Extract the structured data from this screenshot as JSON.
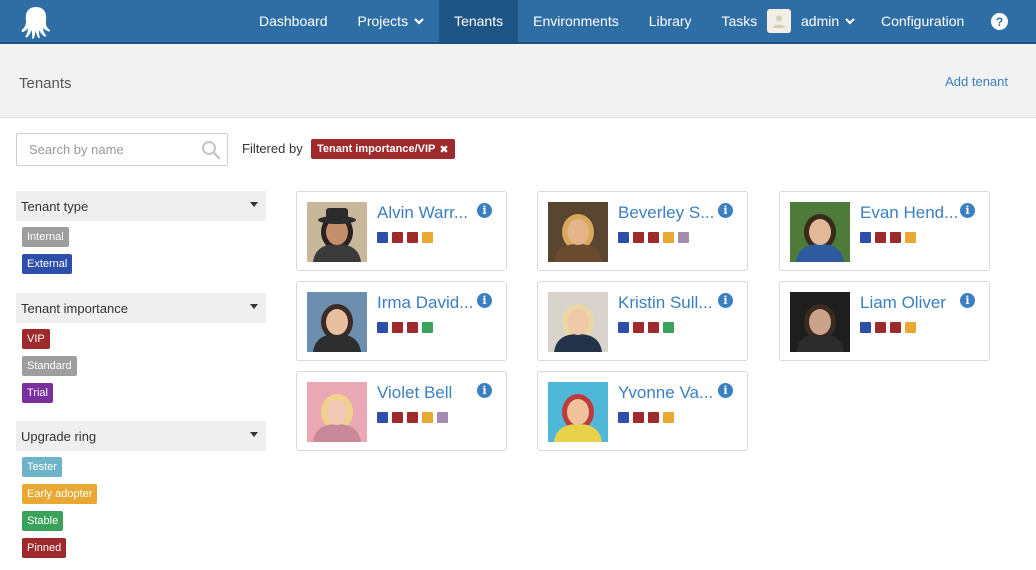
{
  "nav": {
    "items": [
      {
        "label": "Dashboard",
        "active": false,
        "chevron": false
      },
      {
        "label": "Projects",
        "active": false,
        "chevron": true
      },
      {
        "label": "Tenants",
        "active": true,
        "chevron": false
      },
      {
        "label": "Environments",
        "active": false,
        "chevron": false
      },
      {
        "label": "Library",
        "active": false,
        "chevron": false
      },
      {
        "label": "Tasks",
        "active": false,
        "chevron": false
      }
    ],
    "user": "admin",
    "configuration": "Configuration",
    "help": "?"
  },
  "header": {
    "title": "Tenants",
    "add_tenant": "Add tenant"
  },
  "search": {
    "placeholder": "Search by name",
    "value": ""
  },
  "filter": {
    "label": "Filtered by",
    "chip": "Tenant importance/VIP"
  },
  "colors": {
    "brand": "#2f6ea5",
    "link": "#3a7fc1",
    "blue": "#2e4fa9",
    "red": "#9e2a2b",
    "orange": "#e8a831",
    "green": "#3ba25a",
    "gray": "#9e9e9e",
    "purple": "#7a2f9f",
    "mauve": "#a48cb0",
    "teal": "#6fb3c8"
  },
  "sidebar": {
    "groups": [
      {
        "title": "Tenant type",
        "tags": [
          {
            "label": "Internal",
            "color": "#9e9e9e"
          },
          {
            "label": "External",
            "color": "#2e4fa9"
          }
        ]
      },
      {
        "title": "Tenant importance",
        "tags": [
          {
            "label": "VIP",
            "color": "#9e2a2b"
          },
          {
            "label": "Standard",
            "color": "#9e9e9e"
          },
          {
            "label": "Trial",
            "color": "#7a2f9f"
          }
        ]
      },
      {
        "title": "Upgrade ring",
        "tags": [
          {
            "label": "Tester",
            "color": "#6fb3c8"
          },
          {
            "label": "Early adopter",
            "color": "#e8a831"
          },
          {
            "label": "Stable",
            "color": "#3ba25a"
          },
          {
            "label": "Pinned",
            "color": "#9e2a2b"
          }
        ]
      }
    ]
  },
  "tenants": [
    {
      "name": "Alvin Warr...",
      "swatches": [
        "#2e4fa9",
        "#9e2a2b",
        "#9e2a2b",
        "#e8a831"
      ],
      "photo": {
        "bg": "#c9b79c",
        "skin": "#c58f6a",
        "hair": "#2a2220",
        "shirt": "#3a3a3a",
        "hat": true
      }
    },
    {
      "name": "Beverley S...",
      "swatches": [
        "#2e4fa9",
        "#9e2a2b",
        "#9e2a2b",
        "#e8a831",
        "#a48cb0"
      ],
      "photo": {
        "bg": "#5a4630",
        "skin": "#e6b48a",
        "hair": "#d9a85a",
        "shirt": "#6b4b2f",
        "hat": false
      }
    },
    {
      "name": "Evan Hend...",
      "swatches": [
        "#2e4fa9",
        "#9e2a2b",
        "#9e2a2b",
        "#e8a831"
      ],
      "photo": {
        "bg": "#4e7a3a",
        "skin": "#e2b898",
        "hair": "#3a2a1e",
        "shirt": "#2e5aa0",
        "hat": false
      }
    },
    {
      "name": "Irma David...",
      "swatches": [
        "#2e4fa9",
        "#9e2a2b",
        "#9e2a2b",
        "#3ba25a"
      ],
      "photo": {
        "bg": "#6c8fb0",
        "skin": "#e8bfa0",
        "hair": "#3b2b26",
        "shirt": "#2e2e2e",
        "hat": false
      }
    },
    {
      "name": "Kristin Sull...",
      "swatches": [
        "#2e4fa9",
        "#9e2a2b",
        "#9e2a2b",
        "#3ba25a"
      ],
      "photo": {
        "bg": "#d8d3cc",
        "skin": "#efc9a8",
        "hair": "#e9d8a6",
        "shirt": "#24324a",
        "hat": false
      }
    },
    {
      "name": "Liam Oliver",
      "swatches": [
        "#2e4fa9",
        "#9e2a2b",
        "#9e2a2b",
        "#e8a831"
      ],
      "photo": {
        "bg": "#1e1e1e",
        "skin": "#caa48a",
        "hair": "#3a2a20",
        "shirt": "#2b2b2b",
        "hat": false
      }
    },
    {
      "name": "Violet Bell",
      "swatches": [
        "#2e4fa9",
        "#9e2a2b",
        "#9e2a2b",
        "#e8a831",
        "#a48cb0"
      ],
      "photo": {
        "bg": "#e9a8b4",
        "skin": "#f1c9b2",
        "hair": "#f0d28a",
        "shirt": "#c88a9a",
        "hat": false
      }
    },
    {
      "name": "Yvonne Va...",
      "swatches": [
        "#2e4fa9",
        "#9e2a2b",
        "#9e2a2b",
        "#e8a831"
      ],
      "photo": {
        "bg": "#4fb7d8",
        "skin": "#f0c29c",
        "hair": "#c03a3a",
        "shirt": "#e8d24a",
        "hat": false
      }
    }
  ]
}
